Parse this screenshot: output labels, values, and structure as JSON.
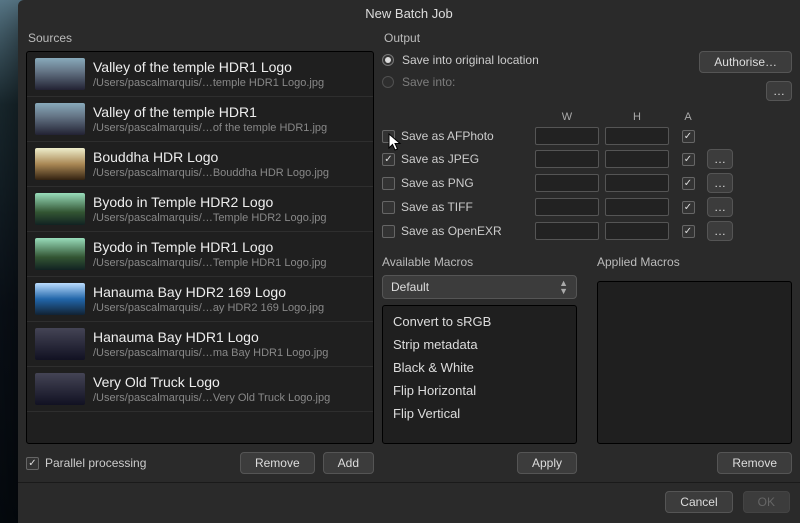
{
  "window_title": "New Batch Job",
  "sources_label": "Sources",
  "sources": [
    {
      "title": "Valley of the temple HDR1 Logo",
      "path": "/Users/pascalmarquis/…temple HDR1 Logo.jpg",
      "thumb": "sky"
    },
    {
      "title": "Valley of the temple HDR1",
      "path": "/Users/pascalmarquis/…of the temple HDR1.jpg",
      "thumb": "sky"
    },
    {
      "title": "Bouddha HDR Logo",
      "path": "/Users/pascalmarquis/…Bouddha HDR Logo.jpg",
      "thumb": "gold"
    },
    {
      "title": "Byodo in Temple HDR2 Logo",
      "path": "/Users/pascalmarquis/…Temple HDR2 Logo.jpg",
      "thumb": "green"
    },
    {
      "title": "Byodo in Temple HDR1 Logo",
      "path": "/Users/pascalmarquis/…Temple HDR1 Logo.jpg",
      "thumb": "green"
    },
    {
      "title": "Hanauma Bay HDR2 169 Logo",
      "path": "/Users/pascalmarquis/…ay HDR2 169 Logo.jpg",
      "thumb": "water"
    },
    {
      "title": "Hanauma Bay HDR1 Logo",
      "path": "/Users/pascalmarquis/…ma Bay HDR1 Logo.jpg",
      "thumb": "dark"
    },
    {
      "title": "Very Old Truck Logo",
      "path": "/Users/pascalmarquis/…Very Old Truck Logo.jpg",
      "thumb": "dark"
    }
  ],
  "parallel_processing_label": "Parallel processing",
  "parallel_processing_checked": true,
  "remove_label": "Remove",
  "add_label": "Add",
  "output_label": "Output",
  "save_original_label": "Save into original location",
  "save_into_label": "Save into:",
  "authorise_label": "Authorise…",
  "browse_label": "…",
  "col_w": "W",
  "col_h": "H",
  "col_a": "A",
  "formats": [
    {
      "label": "Save as AFPhoto",
      "checked": false,
      "a": true,
      "opts": false,
      "cursor": true
    },
    {
      "label": "Save as JPEG",
      "checked": true,
      "a": true,
      "opts": true
    },
    {
      "label": "Save as PNG",
      "checked": false,
      "a": true,
      "opts": true
    },
    {
      "label": "Save as TIFF",
      "checked": false,
      "a": true,
      "opts": true
    },
    {
      "label": "Save as OpenEXR",
      "checked": false,
      "a": true,
      "opts": true
    }
  ],
  "available_macros_label": "Available Macros",
  "applied_macros_label": "Applied Macros",
  "macro_category": "Default",
  "macros": [
    "Convert to sRGB",
    "Strip metadata",
    "Black & White",
    "Flip Horizontal",
    "Flip Vertical"
  ],
  "apply_label": "Apply",
  "remove_macro_label": "Remove",
  "cancel_label": "Cancel",
  "ok_label": "OK"
}
